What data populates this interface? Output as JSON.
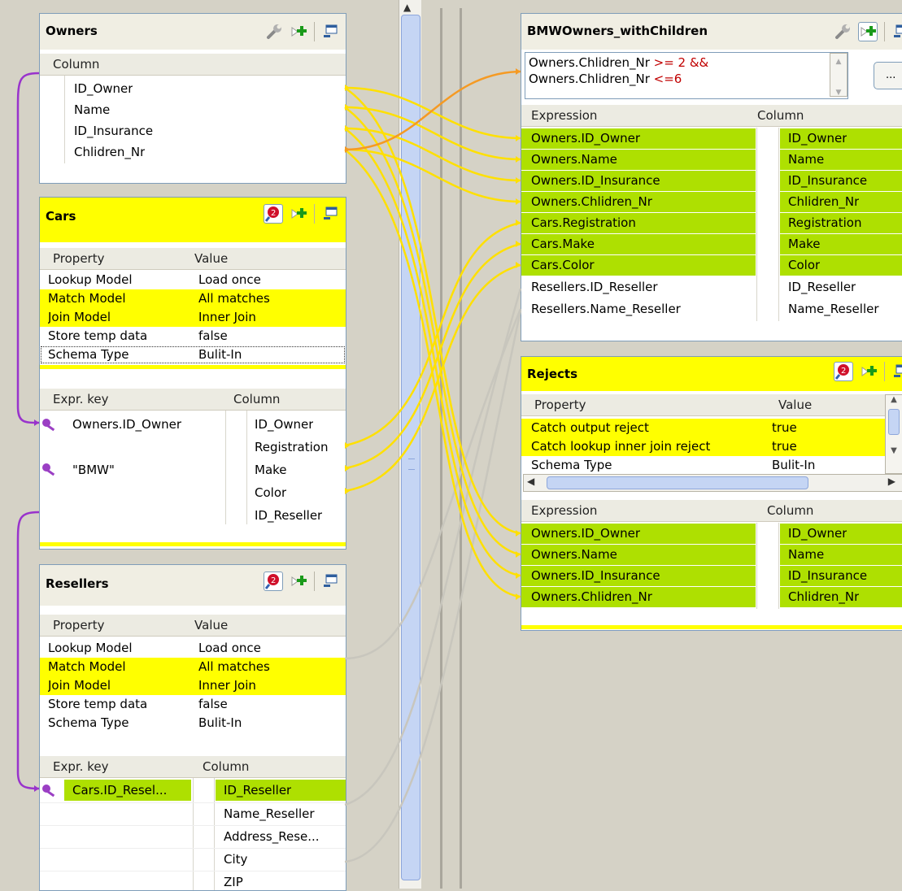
{
  "owners": {
    "title": "Owners",
    "column_header": "Column",
    "columns": [
      "ID_Owner",
      "Name",
      "ID_Insurance",
      "Chlidren_Nr"
    ]
  },
  "cars": {
    "title": "Cars",
    "property_header": "Property",
    "value_header": "Value",
    "properties": [
      {
        "name": "Lookup Model",
        "value": "Load once"
      },
      {
        "name": "Match Model",
        "value": "All matches"
      },
      {
        "name": "Join Model",
        "value": "Inner Join"
      },
      {
        "name": "Store temp data",
        "value": "false"
      },
      {
        "name": "Schema Type",
        "value": "Bulit-In"
      }
    ],
    "expr_key_header": "Expr. key",
    "column_header": "Column",
    "rows": [
      {
        "expr": "Owners.ID_Owner",
        "column": "ID_Owner"
      },
      {
        "expr": "",
        "column": "Registration"
      },
      {
        "expr": "\"BMW\"",
        "column": "Make"
      },
      {
        "expr": "",
        "column": "Color"
      },
      {
        "expr": "",
        "column": "ID_Reseller"
      }
    ]
  },
  "resellers": {
    "title": "Resellers",
    "property_header": "Property",
    "value_header": "Value",
    "properties": [
      {
        "name": "Lookup Model",
        "value": "Load once"
      },
      {
        "name": "Match Model",
        "value": "All matches"
      },
      {
        "name": "Join Model",
        "value": "Inner Join"
      },
      {
        "name": "Store temp data",
        "value": "false"
      },
      {
        "name": "Schema Type",
        "value": "Bulit-In"
      }
    ],
    "expr_key_header": "Expr. key",
    "column_header": "Column",
    "rows": [
      {
        "expr": "Cars.ID_Resel...",
        "column": "ID_Reseller"
      },
      {
        "expr": "",
        "column": "Name_Reseller"
      },
      {
        "expr": "",
        "column": "Address_Rese..."
      },
      {
        "expr": "",
        "column": "City"
      },
      {
        "expr": "",
        "column": "ZIP"
      }
    ]
  },
  "bmw_output": {
    "title": "BMWOwners_withChildren",
    "filter_line1_a": "Owners.Chlidren_Nr ",
    "filter_line1_b": ">= 2 &&",
    "filter_line2_a": "Owners.Chlidren_Nr ",
    "filter_line2_b": "<=6",
    "ellipsis": "...",
    "expression_header": "Expression",
    "column_header": "Column",
    "rows": [
      {
        "expr": "Owners.ID_Owner",
        "column": "ID_Owner"
      },
      {
        "expr": "Owners.Name",
        "column": "Name"
      },
      {
        "expr": "Owners.ID_Insurance",
        "column": "ID_Insurance"
      },
      {
        "expr": "Owners.Chlidren_Nr",
        "column": "Chlidren_Nr"
      },
      {
        "expr": "Cars.Registration",
        "column": "Registration"
      },
      {
        "expr": "Cars.Make",
        "column": "Make"
      },
      {
        "expr": "Cars.Color",
        "column": "Color"
      },
      {
        "expr": "Resellers.ID_Reseller",
        "column": "ID_Reseller"
      },
      {
        "expr": "Resellers.Name_Reseller",
        "column": "Name_Reseller"
      }
    ]
  },
  "rejects": {
    "title": "Rejects",
    "property_header": "Property",
    "value_header": "Value",
    "properties": [
      {
        "name": "Catch output reject",
        "value": "true"
      },
      {
        "name": "Catch lookup inner join reject",
        "value": "true"
      },
      {
        "name": "Schema Type",
        "value": "Bulit-In"
      }
    ],
    "expression_header": "Expression",
    "column_header": "Column",
    "rows": [
      {
        "expr": "Owners.ID_Owner",
        "column": "ID_Owner"
      },
      {
        "expr": "Owners.Name",
        "column": "Name"
      },
      {
        "expr": "Owners.ID_Insurance",
        "column": "ID_Insurance"
      },
      {
        "expr": "Owners.Chlidren_Nr",
        "column": "Chlidren_Nr"
      }
    ]
  },
  "colors": {
    "row_highlight": "#ffff00",
    "mapped_green": "#aee001",
    "link_yellow": "#ffe000",
    "link_orange": "#f59a23",
    "link_purple": "#9933cc",
    "link_grey": "#c8c6bd"
  },
  "icons": [
    "wrench-icon",
    "add-column-icon",
    "minimize-icon",
    "search-error-icon",
    "key-icon"
  ]
}
